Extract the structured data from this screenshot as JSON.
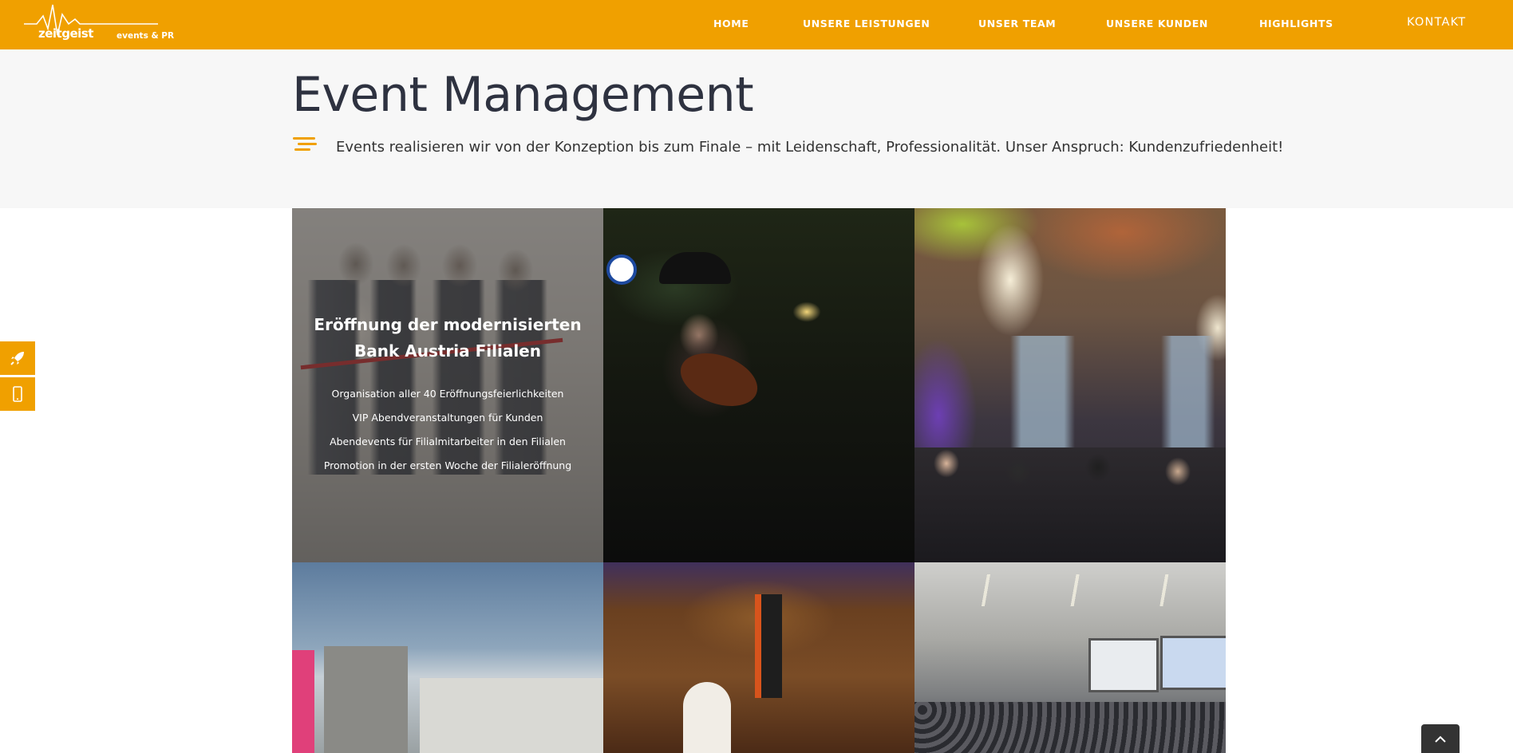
{
  "header": {
    "logo": {
      "brand": "zeitgeist",
      "tagline": "events & PR"
    },
    "nav": [
      {
        "label": "HOME"
      },
      {
        "label": "UNSERE LEISTUNGEN"
      },
      {
        "label": "UNSER TEAM"
      },
      {
        "label": "UNSERE KUNDEN"
      },
      {
        "label": "HIGHLIGHTS"
      },
      {
        "label": "KONTAKT"
      }
    ]
  },
  "title_band": {
    "title": "Event Management",
    "subtitle": "Events realisieren wir von der Konzeption bis zum Finale – mit Leidenschaft, Professionalität. Unser Anspruch: Kundenzufriedenheit!"
  },
  "gallery": {
    "featured": {
      "heading": "Eröffnung der modernisierten Bank Austria Filialen",
      "items": [
        "Organisation aller 40 Eröffnungsfeierlichkeiten",
        "VIP Abendveranstaltungen für Kunden",
        "Abendevents für Filialmitarbeiter in den Filialen",
        "Promotion in der ersten Woche der Filialeröffnung"
      ]
    }
  },
  "side_buttons": {
    "icons": [
      "rocket-icon",
      "mobile-icon"
    ]
  },
  "colors": {
    "accent": "#f0a000",
    "title": "#2e3240",
    "band": "#f7f7f7"
  },
  "scroll_top": {
    "icon": "chevron-up-icon"
  }
}
